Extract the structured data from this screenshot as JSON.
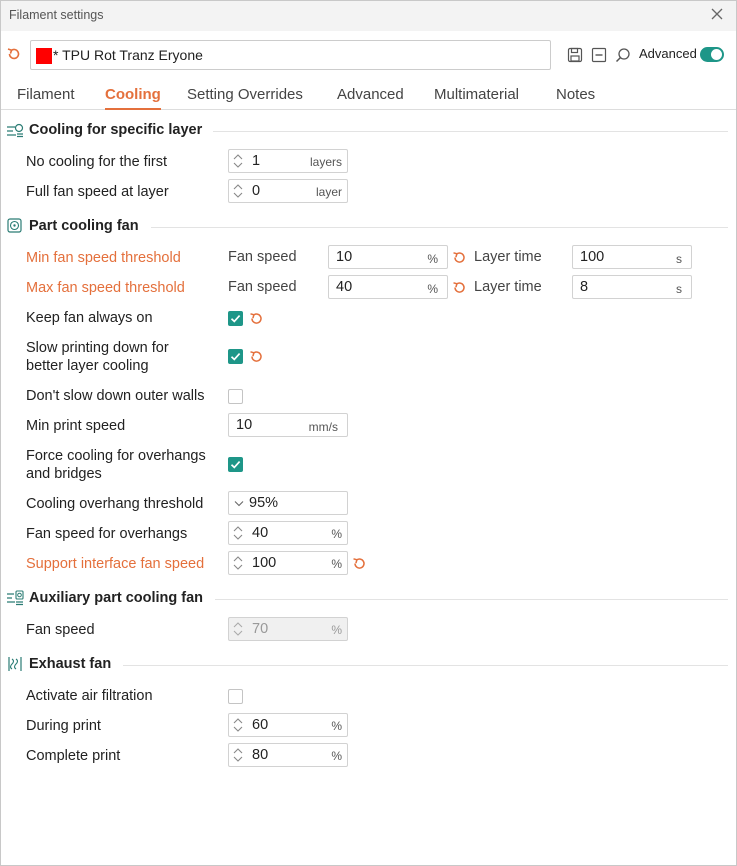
{
  "window": {
    "title": "Filament settings"
  },
  "preset": {
    "name": "* TPU Rot Tranz Eryone",
    "color": "#ff0000",
    "advanced_label": "Advanced",
    "advanced_on": true
  },
  "tabs": [
    {
      "label": "Filament",
      "active": false
    },
    {
      "label": "Cooling",
      "active": true
    },
    {
      "label": "Setting Overrides",
      "active": false
    },
    {
      "label": "Advanced",
      "active": false
    },
    {
      "label": "Multimaterial",
      "active": false
    },
    {
      "label": "Notes",
      "active": false
    }
  ],
  "sections": {
    "specific_layer": {
      "title": "Cooling for specific layer",
      "no_cooling": {
        "label": "No cooling for the first",
        "value": "1",
        "unit": "layers"
      },
      "full_fan": {
        "label": "Full fan speed at layer",
        "value": "0",
        "unit": "layer"
      }
    },
    "part_fan": {
      "title": "Part cooling fan",
      "min_threshold": {
        "label": "Min fan speed threshold",
        "fan_label": "Fan speed",
        "fan_value": "10",
        "fan_unit": "%",
        "time_label": "Layer time",
        "time_value": "100",
        "time_unit": "s"
      },
      "max_threshold": {
        "label": "Max fan speed threshold",
        "fan_label": "Fan speed",
        "fan_value": "40",
        "fan_unit": "%",
        "time_label": "Layer time",
        "time_value": "8",
        "time_unit": "s"
      },
      "keep_fan_on": {
        "label": "Keep fan always on",
        "checked": true
      },
      "slow_down": {
        "label_line1": "Slow printing down for",
        "label_line2": "better layer cooling",
        "checked": true
      },
      "no_slow_outer": {
        "label": "Don't slow down outer walls",
        "checked": false
      },
      "min_print_speed": {
        "label": "Min print speed",
        "value": "10",
        "unit": "mm/s"
      },
      "force_cooling": {
        "label_line1": "Force cooling for overhangs",
        "label_line2": "and bridges",
        "checked": true
      },
      "overhang_threshold": {
        "label": "Cooling overhang threshold",
        "value": "95%"
      },
      "fan_overhangs": {
        "label": "Fan speed for overhangs",
        "value": "40",
        "unit": "%"
      },
      "support_interface": {
        "label": "Support interface fan speed",
        "value": "100",
        "unit": "%"
      }
    },
    "aux_fan": {
      "title": "Auxiliary part cooling fan",
      "fan_speed": {
        "label": "Fan speed",
        "value": "70",
        "unit": "%"
      }
    },
    "exhaust": {
      "title": "Exhaust fan",
      "activate_filtration": {
        "label": "Activate air filtration",
        "checked": false
      },
      "during_print": {
        "label": "During print",
        "value": "60",
        "unit": "%"
      },
      "complete_print": {
        "label": "Complete print",
        "value": "80",
        "unit": "%"
      }
    }
  },
  "colors": {
    "accent": "#1e9688",
    "modified": "#e4703c"
  }
}
